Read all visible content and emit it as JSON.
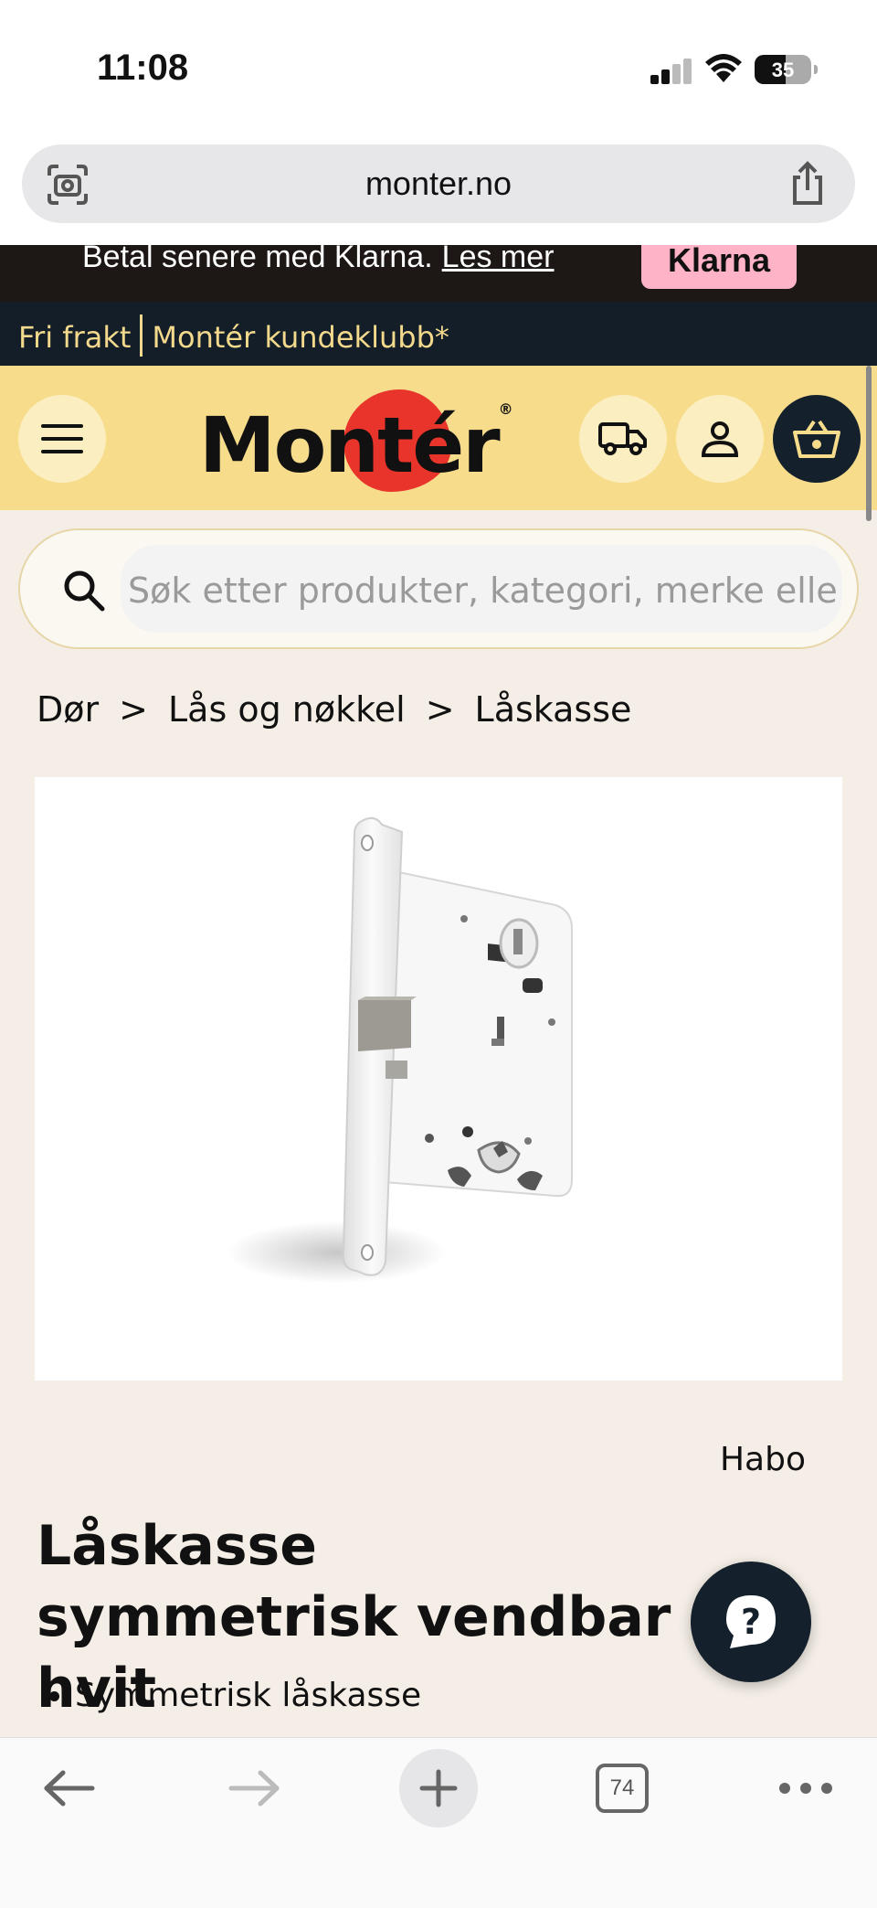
{
  "status_bar": {
    "time": "11:08",
    "battery": "35"
  },
  "browser": {
    "url": "monter.no",
    "tab_count": "74"
  },
  "promo": {
    "text": "Betal senere med Klarna.",
    "link": "Les mer",
    "badge": "Klarna"
  },
  "club_bar": {
    "left": "Fri frakt",
    "right": "Montér kundeklubb*"
  },
  "header": {
    "logo_text": "Montér",
    "logo_mark": "®"
  },
  "search": {
    "placeholder": "Søk etter produkter, kategori, merke eller prosjekt"
  },
  "breadcrumb": {
    "items": [
      "Dør",
      "Lås og nøkkel",
      "Låskasse"
    ],
    "separator": ">"
  },
  "product": {
    "brand": "Habo",
    "title": "Låskasse symmetrisk vendbar hvit",
    "bullets": [
      "Symmetrisk låskasse"
    ]
  },
  "colors": {
    "header_bg": "#f7dc8c",
    "club_bg": "#141e28",
    "club_text": "#f2d98c",
    "logo_red": "#e8342a",
    "klarna_pink": "#ffb3c7",
    "page_bg": "#f4eee6"
  },
  "icons": [
    "camera-search-icon",
    "share-icon",
    "menu-icon",
    "truck-icon",
    "user-icon",
    "basket-icon",
    "search-icon",
    "help-icon",
    "back-arrow-icon",
    "forward-arrow-icon",
    "plus-icon",
    "tabs-icon",
    "more-icon"
  ]
}
